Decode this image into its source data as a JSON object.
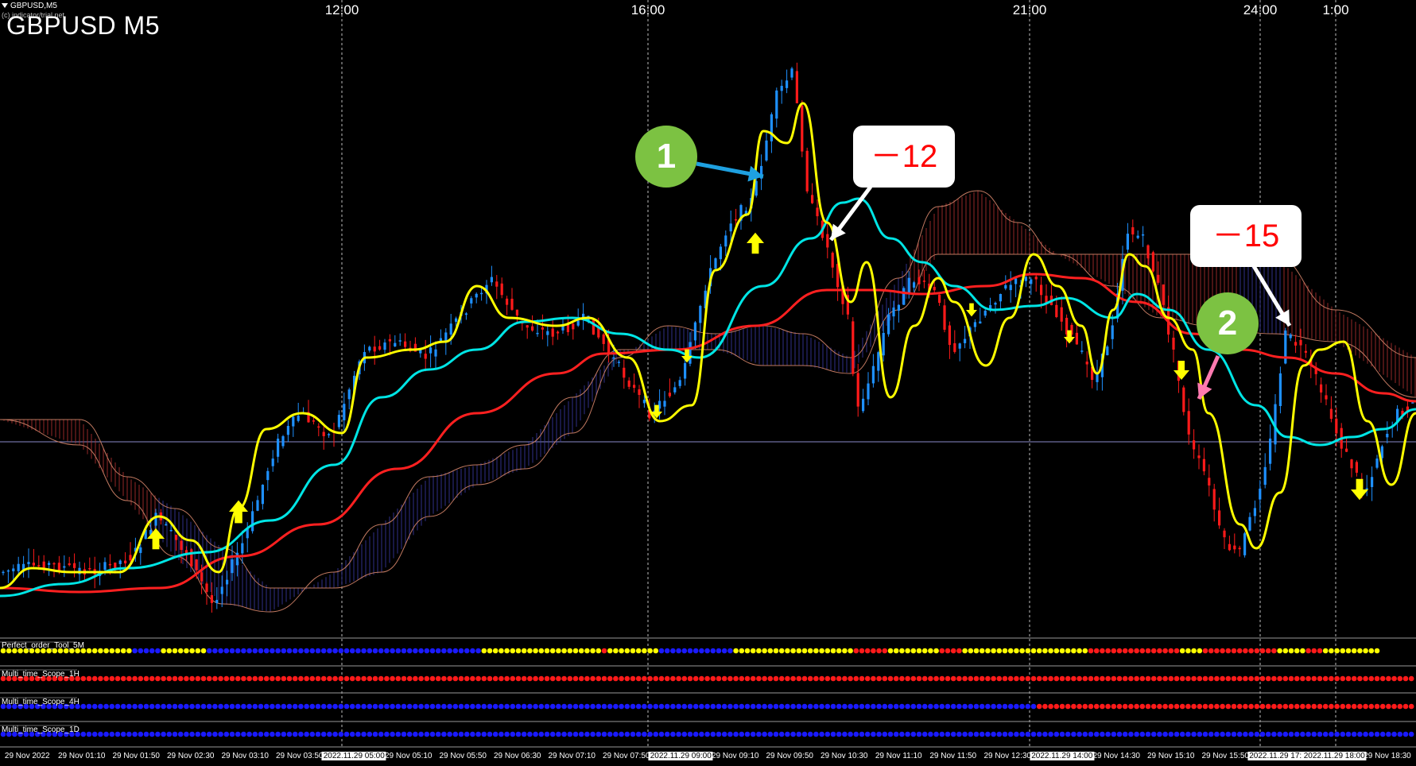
{
  "window": {
    "tab_label": "GBPUSD,M5",
    "sub_label": "(c) indicator/trial.net",
    "title": "GBPUSD M5"
  },
  "time_axis_top": [
    "12:00",
    "16:00",
    "21:00",
    "24:00",
    "1:00"
  ],
  "indicator_panels": [
    {
      "label": "Perfect_order_Tool_5M"
    },
    {
      "label": "Multi_time_Scope_1H"
    },
    {
      "label": "Multi_time_Scope_4H"
    },
    {
      "label": "Multi_time_Scope_1D"
    }
  ],
  "bottom_axis": {
    "labels": [
      "29 Nov 2022",
      "29 Nov 01:10",
      "29 Nov 01:50",
      "29 Nov 02:30",
      "29 Nov 03:10",
      "29 Nov 03:50",
      "2022.11.29 05:00",
      "29 Nov 05:10",
      "29 Nov 05:50",
      "29 Nov 06:30",
      "29 Nov 07:10",
      "29 Nov 07:50",
      "2022.11.29 09:00",
      "29 Nov 09:10",
      "29 Nov 09:50",
      "29 Nov 10:30",
      "29 Nov 11:10",
      "29 Nov 11:50",
      "29 Nov 12:30",
      "2022.11.29 14:00",
      "29 Nov 14:30",
      "29 Nov 15:10",
      "29 Nov 15:50",
      "2022.11.29 17:00",
      "2022.11.29 18:00",
      "29 Nov 18:30"
    ]
  },
  "annotations": {
    "marker1": "1",
    "marker2": "2",
    "loss1": "－12",
    "loss2": "－15"
  },
  "colors": {
    "background": "#000000",
    "bull_candle": "#1e90ff",
    "bear_candle": "#ff1a1a",
    "ma_fast": "#ffff00",
    "ma_mid": "#00e5e5",
    "ma_slow": "#ff2020",
    "callout_green": "#7cc242",
    "arrow_blue": "#1ea0e0",
    "arrow_pink": "#ff7ab0",
    "loss_text": "#ff0000"
  }
}
